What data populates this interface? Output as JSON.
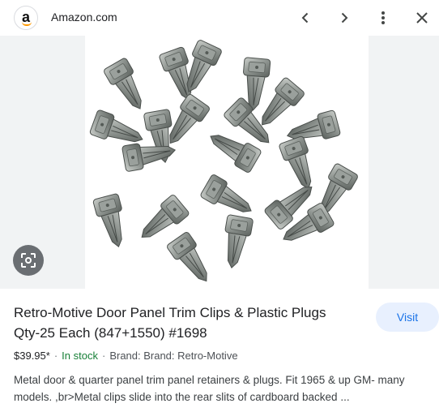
{
  "header": {
    "logo_letter": "a",
    "site_name": "Amazon.com",
    "icons": [
      "chevron-left-icon",
      "chevron-right-icon",
      "more-vert-icon",
      "close-icon"
    ]
  },
  "image": {
    "subject": "Metal door panel trim clips",
    "lens_icon": "lens-icon"
  },
  "product": {
    "title": "Retro-Motive Door Panel Trim Clips & Plastic Plugs Qty-25 Each (847+1550) #1698",
    "visit_label": "Visit",
    "price": "$39.95*",
    "stock": "In stock",
    "brand": "Brand: Brand: Retro-Motive",
    "description": "Metal door & quarter panel trim panel retainers & plugs. Fit 1965 & up GM- many models. ,br>Metal clips slide into the rear slits of cardboard backed ..."
  },
  "colors": {
    "accent": "#1a73e8",
    "visit_bg": "#e8f0fe",
    "stock_green": "#188038",
    "amazon_orange": "#ff9900"
  }
}
